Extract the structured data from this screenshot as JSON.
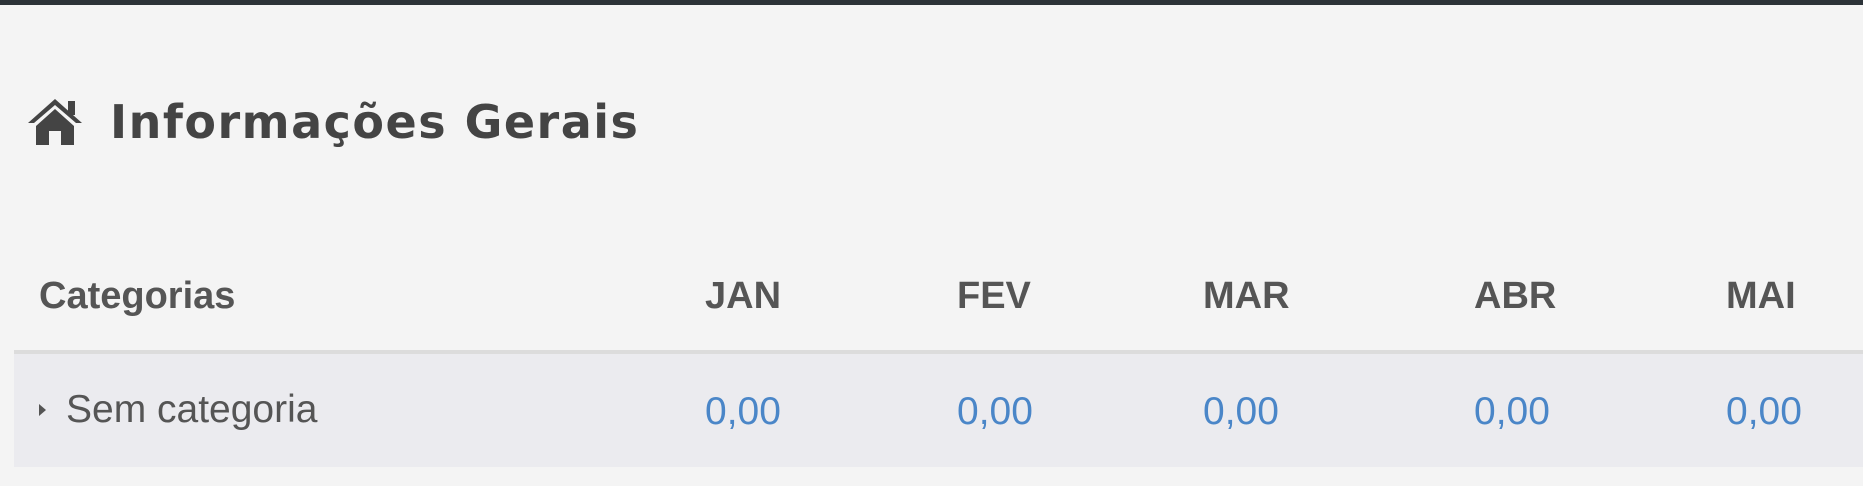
{
  "header": {
    "icon": "home-icon",
    "title": "Informações Gerais"
  },
  "table": {
    "columns": [
      "Categorias",
      "JAN",
      "FEV",
      "MAR",
      "ABR",
      "MAI"
    ],
    "rows": [
      {
        "category": "Sem categoria",
        "values": [
          "0,00",
          "0,00",
          "0,00",
          "0,00",
          "0,00"
        ]
      }
    ]
  },
  "colors": {
    "top_bar": "#2c3338",
    "background": "#f4f4f4",
    "title": "#444444",
    "value_link": "#4a86c8",
    "row_background": "#ebebef"
  }
}
